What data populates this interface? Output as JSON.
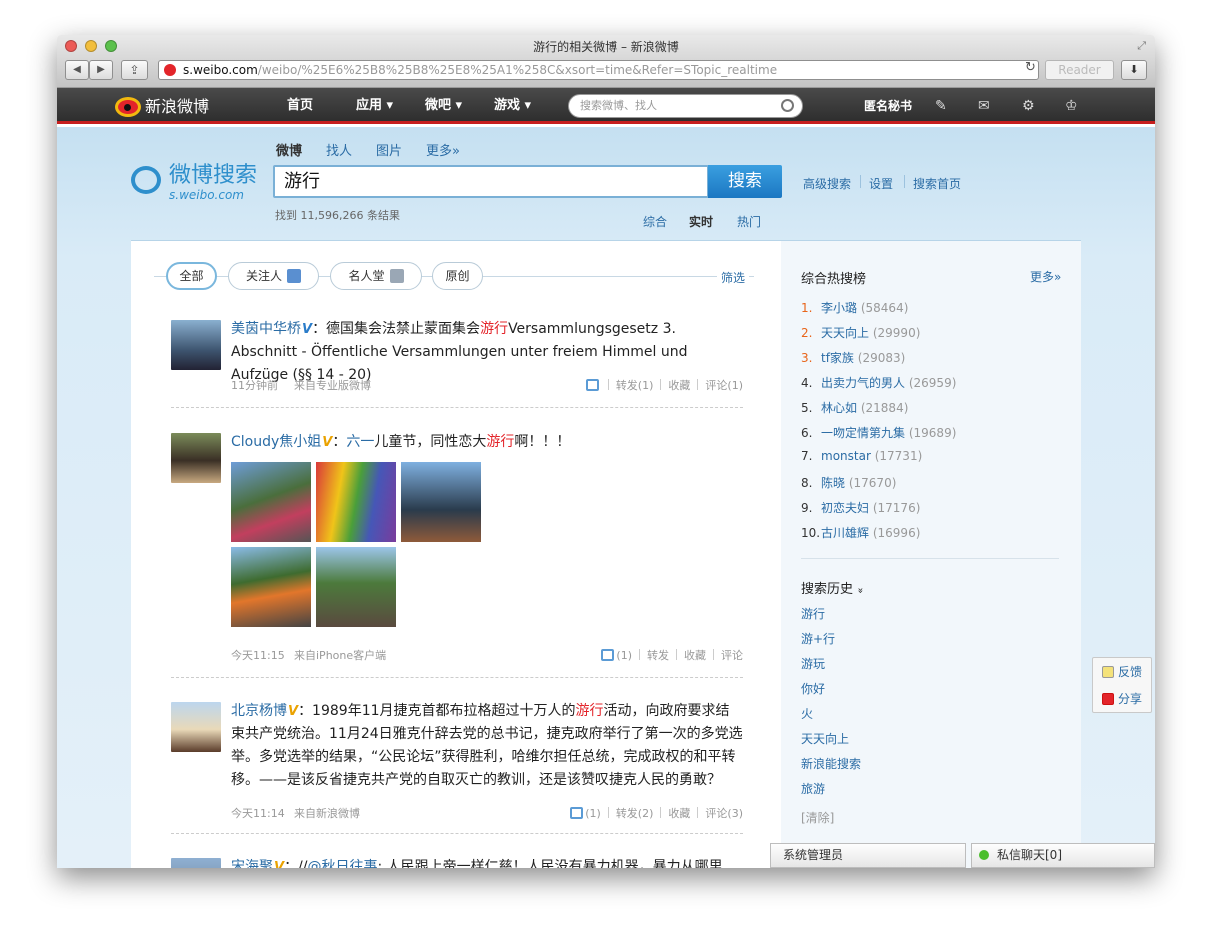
{
  "window": {
    "title": "游行的相关微博 – 新浪微博"
  },
  "browser": {
    "url_domain": "s.weibo.com",
    "url_path": "/weibo/%25E6%25B8%25B8%25E8%25A1%258C&xsort=time&Refer=STopic_realtime",
    "reader_label": "Reader",
    "back_icon": "◀",
    "fwd_icon": "▶",
    "share_icon": "⇪",
    "reload_icon": "↻",
    "download_icon": "⬇",
    "fullscreen_icon": "⤢"
  },
  "nav": {
    "logo_text": "新浪微博",
    "items": [
      "首页",
      "应用 ▾",
      "微吧 ▾",
      "游戏 ▾"
    ],
    "search_placeholder": "搜索微博、找人",
    "anon": "匿名秘书",
    "icons": [
      "✎",
      "✉",
      "⚙",
      "♔"
    ]
  },
  "search": {
    "logo_text": "微博搜索",
    "logo_sub": "s.weibo.com",
    "tabs": [
      "微博",
      "找人",
      "图片",
      "更多»"
    ],
    "query": "游行",
    "button": "搜索",
    "links": [
      "高级搜索",
      "设置",
      "搜索首页"
    ],
    "result_count": "找到 11,596,266 条结果",
    "mode_tabs": [
      "综合",
      "实时",
      "热门"
    ]
  },
  "filters": {
    "buttons": [
      "全部",
      "关注人",
      "名人堂",
      "原创"
    ],
    "link": "筛选"
  },
  "posts": [
    {
      "name": "美茵中华桥",
      "badge": "V",
      "pre": "：德国集会法禁止蒙面集会",
      "hl": "游行",
      "post": "Versammlungsgesetz 3. Abschnitt - Öffentliche Versammlungen unter freiem Himmel und Aufzüge (§§ 14 - 20)",
      "time": "11分钟前",
      "source": "来自专业版微博",
      "like": "",
      "repost": "转发(1)",
      "fav": "收藏",
      "comment": "评论(1)"
    },
    {
      "name": "Cloudy焦小姐",
      "badge": "V",
      "pre": "：",
      "topic": "六一",
      "pre2": "儿童节，同性恋大",
      "hl": "游行",
      "post": "啊！！！",
      "time": "今天11:15",
      "source": "来自iPhone客户端",
      "like": "(1)",
      "repost": "转发",
      "fav": "收藏",
      "comment": "评论"
    },
    {
      "name": "北京杨博",
      "badge": "V",
      "pre": "：1989年11月捷克首都布拉格超过十万人的",
      "hl": "游行",
      "post": "活动，向政府要求结束共产党统治。11月24日雅克什辞去党的总书记，捷克政府举行了第一次的多党选举。多党选举的结果，“公民论坛”获得胜利，哈维尔担任总统，完成政权的和平转移。——是该反省捷克共产党的自取灭亡的教训，还是该赞叹捷克人民的勇敢？",
      "time": "今天11:14",
      "source": "来自新浪微博",
      "like": "(1)",
      "repost": "转发(2)",
      "fav": "收藏",
      "comment": "评论(3)"
    },
    {
      "name": "宋海聚",
      "badge": "V",
      "pre": "：//",
      "mention": "@秋日往事",
      "post": ": 人民跟上帝一样仁慈！人民没有暴力机器，暴力从哪里"
    }
  ],
  "side": {
    "hot_title": "综合热搜榜",
    "more": "更多»",
    "hot": [
      {
        "rank": "1.",
        "name": "李小璐",
        "count": "(58464)"
      },
      {
        "rank": "2.",
        "name": "天天向上",
        "count": "(29990)"
      },
      {
        "rank": "3.",
        "name": "tf家族",
        "count": "(29083)"
      },
      {
        "rank": "4.",
        "name": "出卖力气的男人",
        "count": "(26959)"
      },
      {
        "rank": "5.",
        "name": "林心如",
        "count": "(21884)"
      },
      {
        "rank": "6.",
        "name": "一吻定情第九集",
        "count": "(19689)"
      },
      {
        "rank": "7.",
        "name": "monstar",
        "count": "(17731)"
      },
      {
        "rank": "8.",
        "name": "陈晓",
        "count": "(17670)"
      },
      {
        "rank": "9.",
        "name": "初恋夫妇",
        "count": "(17176)"
      },
      {
        "rank": "10.",
        "name": "古川雄辉",
        "count": "(16996)"
      }
    ],
    "history_title": "搜索历史",
    "history_icon": "»",
    "history": [
      "游行",
      "游+行",
      "游玩",
      "你好",
      "火",
      "天天向上",
      "新浪能搜索",
      "旅游"
    ],
    "clear": "[清除]"
  },
  "feedback": {
    "feedback": "反馈",
    "share": "分享"
  },
  "bottom": {
    "admin": "系统管理员",
    "chat": "私信聊天[0]"
  },
  "colors": {
    "accent": "#2b6ca5",
    "highlight": "#e3242a",
    "nav_bg": "#3a3a3a",
    "search_btn": "#1b77c2"
  }
}
